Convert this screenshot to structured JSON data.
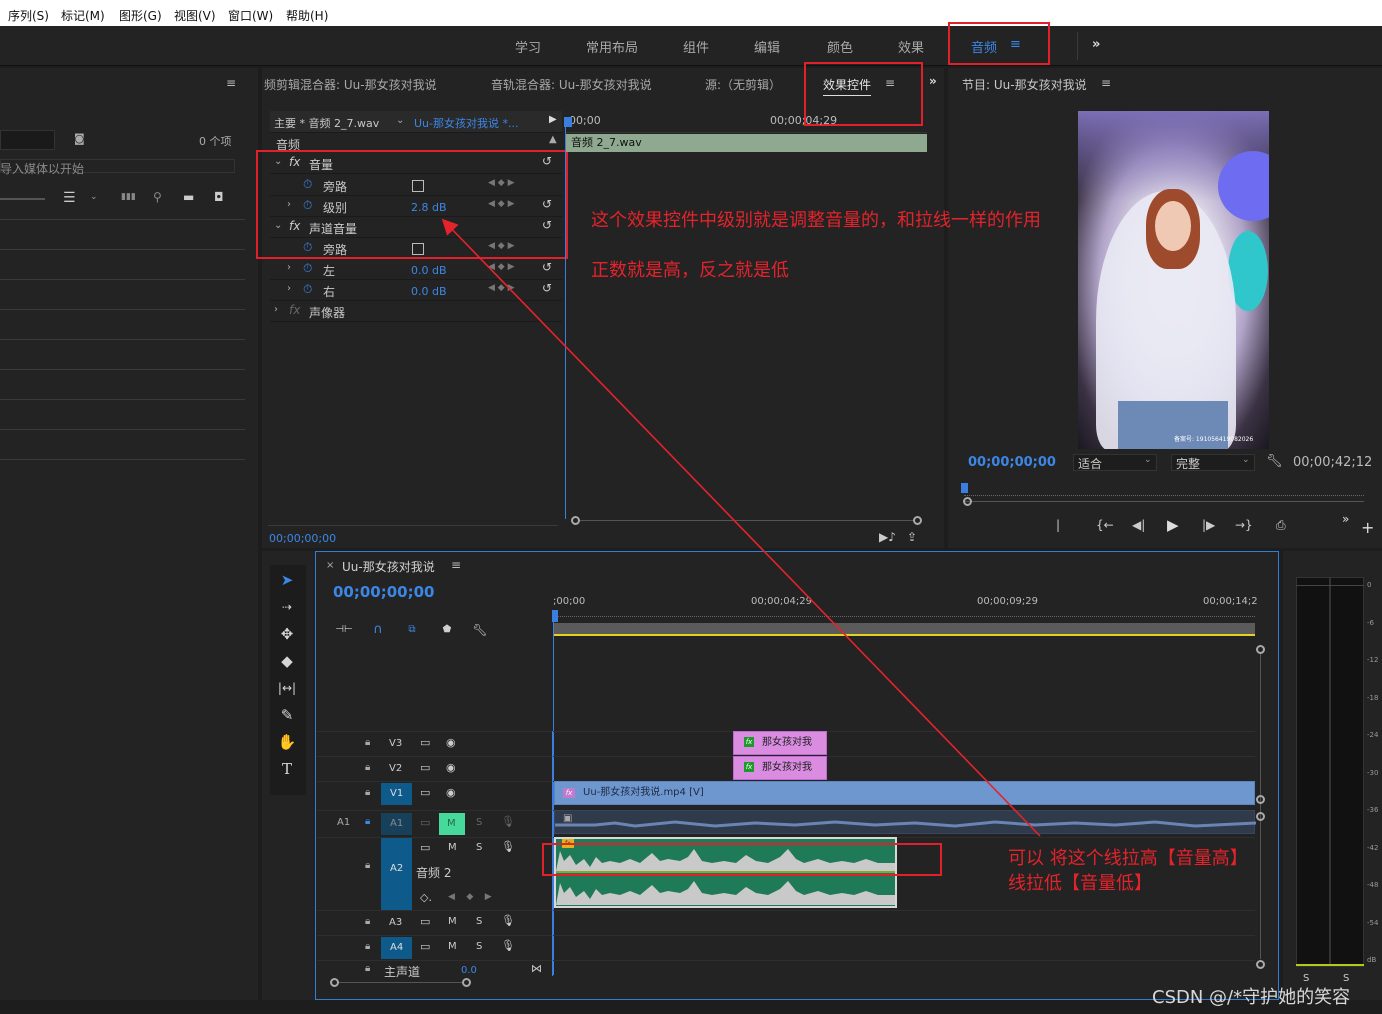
{
  "menu": [
    "序列(S)",
    "标记(M)",
    "图形(G)",
    "视图(V)",
    "窗口(W)",
    "帮助(H)"
  ],
  "workspaces": [
    "学习",
    "常用布局",
    "组件",
    "编辑",
    "颜色",
    "效果"
  ],
  "active_workspace": "音频",
  "left_panel": {
    "item_count": "0 个项",
    "import_hint": "导入媒体以开始"
  },
  "source_tabs": {
    "clip_mixer": "频剪辑混合器: Uu-那女孩对我说",
    "track_mixer": "音轨混合器: Uu-那女孩对我说",
    "source": "源:（无剪辑）",
    "effect_controls": "效果控件"
  },
  "effect_controls": {
    "master_clip": "主要 * 音频 2_7.wav",
    "sequence_clip": "Uu-那女孩对我说 *...",
    "ruler_start": "00;00",
    "ruler_end": "00;00;04;29",
    "section": "音频",
    "clip_bar": "音频 2_7.wav",
    "volume": "音量",
    "bypass": "旁路",
    "level": "级别",
    "level_value": "2.8 dB",
    "channel_volume": "声道音量",
    "bypass2": "旁路",
    "left": "左",
    "left_value": "0.0 dB",
    "right": "右",
    "right_value": "0.0 dB",
    "panner": "声像器",
    "timecode": "00;00;00;00"
  },
  "program": {
    "title": "节目: Uu-那女孩对我说",
    "timecode": "00;00;00;00",
    "fit": "适合",
    "quality": "完整",
    "duration": "00;00;42;12",
    "watermark": "备案号: 191056419082026"
  },
  "timeline": {
    "tab": "Uu-那女孩对我说",
    "timecode": "00;00;00;00",
    "ruler": [
      ";00;00",
      "00;00;04;29",
      "00;00;09;29",
      "00;00;14;2"
    ],
    "tracks": {
      "v3": "V3",
      "v2": "V2",
      "v1": "V1",
      "a1": "A1",
      "a2": "A2",
      "a3": "A3",
      "a4": "A4",
      "a1_src": "A1",
      "a2_name": "音频 2",
      "master": "主声道",
      "master_value": "0.0"
    },
    "clips": {
      "v3": "那女孩对我",
      "v2": "那女孩对我",
      "v1": "Uu-那女孩对我说.mp4 [V]"
    }
  },
  "meter_ticks": [
    "0",
    "-6",
    "-12",
    "-18",
    "-24",
    "-30",
    "-36",
    "-42",
    "-48",
    "-54",
    "dB"
  ],
  "meter_solo": [
    "S",
    "S"
  ],
  "annotations": {
    "a1": "这个效果控件中级别就是调整音量的，和拉线一样的作用",
    "a2": "正数就是高，反之就是低",
    "a3": "可以 将这个线拉高【音量高】",
    "a4": "线拉低【音量低】"
  },
  "watermark": "CSDN @/*守护她的笑容",
  "colors": {
    "accent": "#3c87e6",
    "annotation": "#e4232b",
    "audio_clip": "#1e7a57",
    "video_clip": "#6e97cf",
    "graphic_clip": "#d98ce0",
    "track_target": "#0e5a8a"
  }
}
